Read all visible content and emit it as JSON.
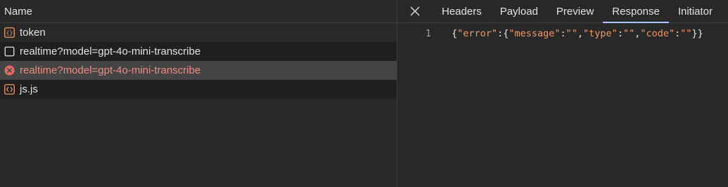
{
  "list": {
    "header": "Name",
    "rows": [
      {
        "icon": "json-braces-icon",
        "label": "token",
        "status": "ok"
      },
      {
        "icon": "document-icon",
        "label": "realtime?model=gpt-4o-mini-transcribe",
        "status": "ok"
      },
      {
        "icon": "error-circle-icon",
        "label": "realtime?model=gpt-4o-mini-transcribe",
        "status": "error"
      },
      {
        "icon": "script-icon",
        "label": "js.js",
        "status": "ok"
      }
    ]
  },
  "detail": {
    "close_icon": "close-icon",
    "tabs": [
      "Headers",
      "Payload",
      "Preview",
      "Response",
      "Initiator"
    ],
    "active_tab": "Response",
    "response": {
      "line_number": "1",
      "tokens": [
        {
          "t": "{",
          "k": "punc"
        },
        {
          "t": "\"error\"",
          "k": "key"
        },
        {
          "t": ":",
          "k": "punc"
        },
        {
          "t": "{",
          "k": "punc"
        },
        {
          "t": "\"message\"",
          "k": "key"
        },
        {
          "t": ":",
          "k": "punc"
        },
        {
          "t": "\"\"",
          "k": "str"
        },
        {
          "t": ",",
          "k": "punc"
        },
        {
          "t": "\"type\"",
          "k": "key"
        },
        {
          "t": ":",
          "k": "punc"
        },
        {
          "t": "\"\"",
          "k": "str"
        },
        {
          "t": ",",
          "k": "punc"
        },
        {
          "t": "\"code\"",
          "k": "key"
        },
        {
          "t": ":",
          "k": "punc"
        },
        {
          "t": "\"\"",
          "k": "str"
        },
        {
          "t": "}}",
          "k": "punc"
        }
      ]
    }
  },
  "colors": {
    "background": "#282828",
    "row_alt": "#1f1f1f",
    "row_selected": "#444444",
    "error_text": "#f08c80",
    "error_icon": "#e46962",
    "json_icon": "#f29766",
    "key_color": "#f29766",
    "tab_indicator": "#a8c7fa"
  }
}
